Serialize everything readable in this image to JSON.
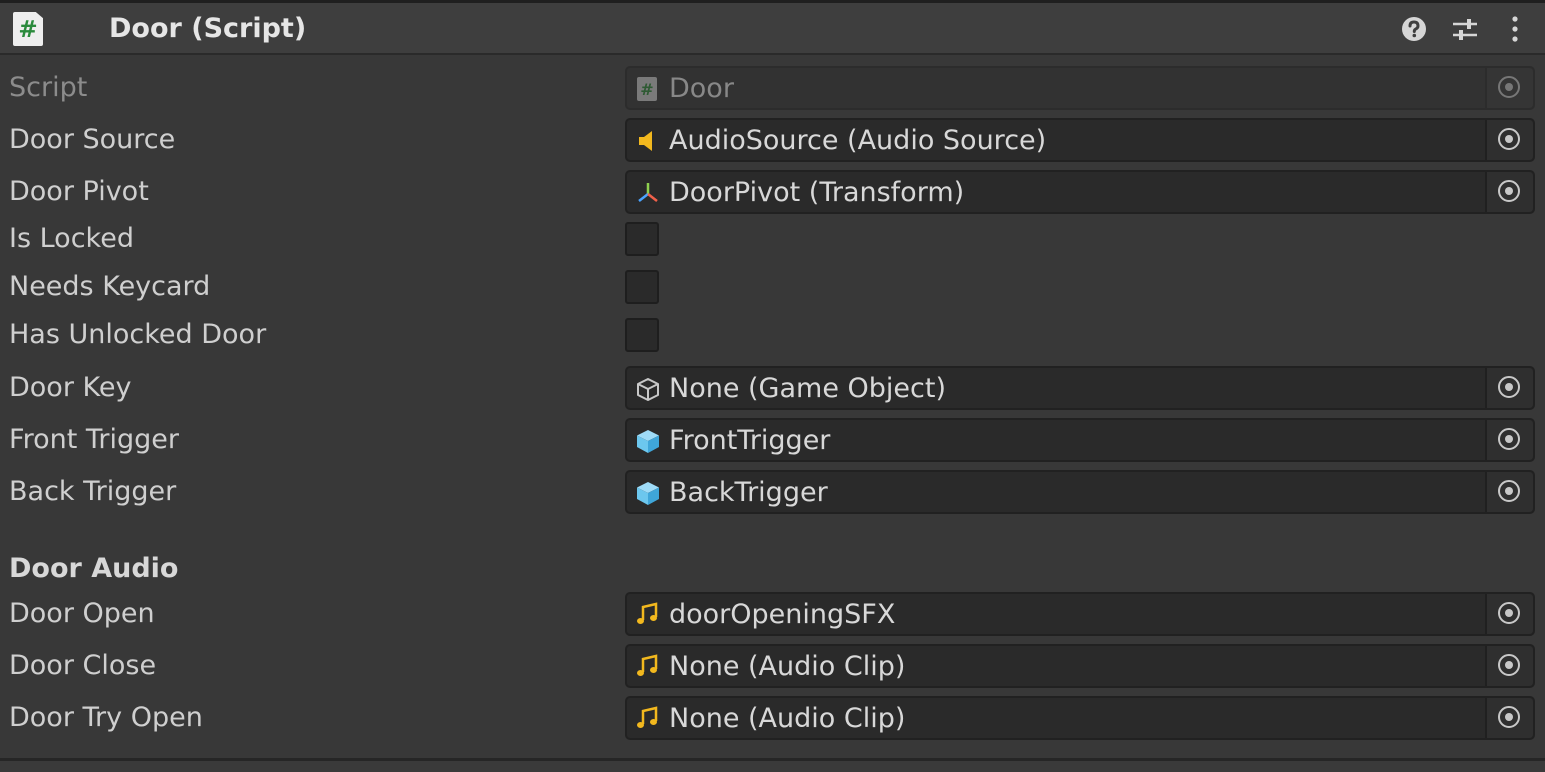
{
  "component": {
    "title": "Door (Script)",
    "icon": "csharp-script-icon"
  },
  "header_buttons": [
    "help-icon",
    "presets-icon",
    "kebab-menu-icon"
  ],
  "fields": {
    "script": {
      "label": "Script",
      "value": "Door",
      "icon": "csharp-script-icon"
    },
    "door_source": {
      "label": "Door Source",
      "value": "AudioSource (Audio Source)",
      "icon": "audio-source-icon"
    },
    "door_pivot": {
      "label": "Door Pivot",
      "value": "DoorPivot (Transform)",
      "icon": "transform-icon"
    },
    "is_locked": {
      "label": "Is Locked",
      "checked": false
    },
    "needs_keycard": {
      "label": "Needs Keycard",
      "checked": false
    },
    "has_unlocked_door": {
      "label": "Has Unlocked Door",
      "checked": false
    },
    "door_key": {
      "label": "Door Key",
      "value": "None (Game Object)",
      "icon": "gameobject-outline-icon"
    },
    "front_trigger": {
      "label": "Front Trigger",
      "value": "FrontTrigger",
      "icon": "prefab-cube-icon"
    },
    "back_trigger": {
      "label": "Back Trigger",
      "value": "BackTrigger",
      "icon": "prefab-cube-icon"
    }
  },
  "door_audio": {
    "header": "Door Audio",
    "door_open": {
      "label": "Door Open",
      "value": "doorOpeningSFX",
      "icon": "audio-clip-icon"
    },
    "door_close": {
      "label": "Door Close",
      "value": "None (Audio Clip)",
      "icon": "audio-clip-icon"
    },
    "door_try_open": {
      "label": "Door Try Open",
      "value": "None (Audio Clip)",
      "icon": "audio-clip-icon"
    }
  },
  "colors": {
    "background": "#383838",
    "field_background": "#2a2a2a",
    "script_green": "#2a8a3c",
    "audio_yellow": "#f2b81e",
    "prefab_blue": "#6cc7ee"
  }
}
